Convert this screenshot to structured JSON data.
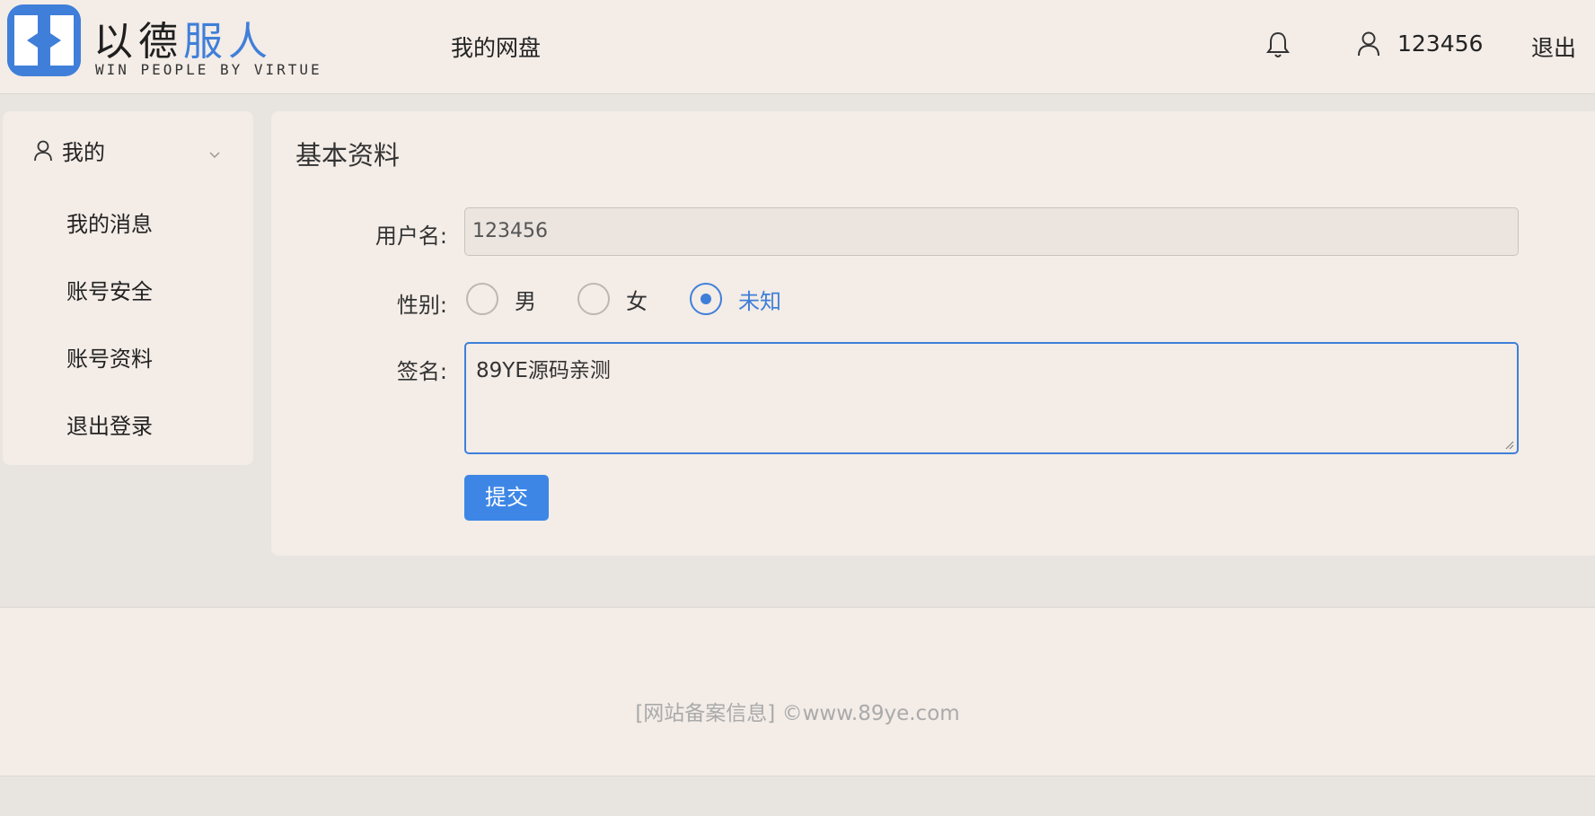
{
  "header": {
    "logo_icon": "k-logo-icon",
    "logo_title_dark": "以德",
    "logo_title_accent": "服人",
    "logo_subtitle": "WIN PEOPLE BY VIRTUE",
    "nav_link": "我的网盘",
    "bell_icon": "bell-icon",
    "user_icon": "user-icon",
    "username": "123456",
    "logout": "退出"
  },
  "sidebar": {
    "group_icon": "user-icon",
    "group_label": "我的",
    "group_caret": "chevron-down-icon",
    "items": [
      "我的消息",
      "账号安全",
      "账号资料",
      "退出登录"
    ]
  },
  "form": {
    "title": "基本资料",
    "username_label": "用户名:",
    "username_value": "123456",
    "gender_label": "性别:",
    "gender_options": [
      "男",
      "女",
      "未知"
    ],
    "gender_selected": "未知",
    "signature_label": "签名:",
    "signature_value": "89YE源码亲测",
    "submit_label": "提交"
  },
  "footer": {
    "text": "[网站备案信息] ©www.89ye.com"
  },
  "colors": {
    "accent": "#3f7fd9",
    "button": "#3d86e6",
    "surface": "#f3ece7",
    "background": "#e8e4e0"
  }
}
